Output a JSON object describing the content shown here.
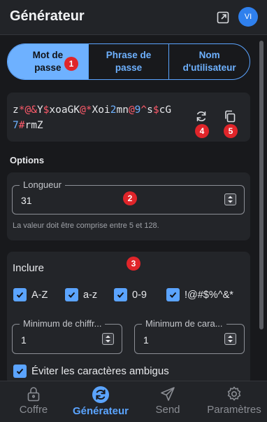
{
  "header": {
    "title": "Générateur",
    "popout_icon": "popout-icon",
    "avatar_initials": "VI"
  },
  "type_selector": {
    "options": [
      {
        "label": "Mot de passe",
        "selected": true
      },
      {
        "label": "Phrase de passe",
        "selected": false
      },
      {
        "label": "Nom d'utilisateur",
        "selected": false
      }
    ]
  },
  "password": {
    "line1": [
      {
        "t": "z",
        "k": "c"
      },
      {
        "t": "*@&",
        "k": "s"
      },
      {
        "t": "Y",
        "k": "c"
      },
      {
        "t": "$",
        "k": "s"
      },
      {
        "t": "xoaGK",
        "k": "c"
      },
      {
        "t": "@*",
        "k": "s"
      },
      {
        "t": "Xoi",
        "k": "c"
      },
      {
        "t": "2",
        "k": "n"
      },
      {
        "t": "mn",
        "k": "c"
      },
      {
        "t": "@",
        "k": "s"
      },
      {
        "t": "9",
        "k": "n"
      },
      {
        "t": "^",
        "k": "s"
      },
      {
        "t": "s",
        "k": "c"
      },
      {
        "t": "$",
        "k": "s"
      },
      {
        "t": "cG",
        "k": "c"
      }
    ],
    "line2": [
      {
        "t": "7",
        "k": "n"
      },
      {
        "t": "#",
        "k": "s"
      },
      {
        "t": "rmZ",
        "k": "c"
      }
    ],
    "regenerate_icon": "refresh-icon",
    "copy_icon": "copy-icon"
  },
  "options": {
    "title": "Options",
    "length": {
      "label": "Longueur",
      "value": "31",
      "hint": "La valeur doit être comprise entre 5 et 128."
    },
    "include": {
      "title": "Inclure",
      "checkboxes": [
        {
          "label": "A-Z",
          "checked": true
        },
        {
          "label": "a-z",
          "checked": true
        },
        {
          "label": "0-9",
          "checked": true
        },
        {
          "label": "!@#$%^&*",
          "checked": true
        }
      ],
      "min_numbers": {
        "label": "Minimum de chiffr...",
        "value": "1"
      },
      "min_special": {
        "label": "Minimum de cara...",
        "value": "1"
      },
      "avoid_ambiguous": {
        "label": "Éviter les caractères ambigus",
        "checked": true
      }
    }
  },
  "badges": [
    "1",
    "2",
    "3",
    "4",
    "5"
  ],
  "nav": {
    "items": [
      {
        "label": "Coffre",
        "icon": "vault-lock-icon",
        "active": false
      },
      {
        "label": "Générateur",
        "icon": "generator-refresh-icon",
        "active": true
      },
      {
        "label": "Send",
        "icon": "send-paper-plane-icon",
        "active": false
      },
      {
        "label": "Paramètres",
        "icon": "settings-gear-icon",
        "active": false
      }
    ]
  },
  "colors": {
    "accent": "#5ba4ff",
    "badge": "#e0252a",
    "special_char": "#ff5b6b",
    "digit_char": "#6eb1ff",
    "background": "#18191c",
    "card": "#232529"
  }
}
